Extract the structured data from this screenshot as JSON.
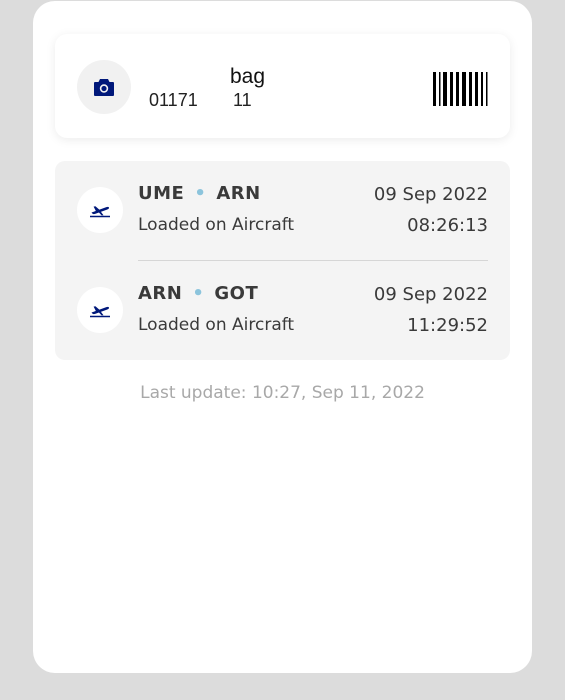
{
  "bag": {
    "title": "bag",
    "number_prefix": "01171",
    "number_suffix": "11",
    "camera_icon": "camera-icon",
    "barcode_icon": "barcode-icon"
  },
  "segments": [
    {
      "origin": "UME",
      "separator": "•",
      "destination": "ARN",
      "status": "Loaded on Aircraft",
      "date": "09 Sep 2022",
      "time": "08:26:13",
      "icon": "airplane-departure-icon"
    },
    {
      "origin": "ARN",
      "separator": "•",
      "destination": "GOT",
      "status": "Loaded on Aircraft",
      "date": "09 Sep 2022",
      "time": "11:29:52",
      "icon": "airplane-departure-icon"
    }
  ],
  "footer": {
    "last_update": "Last update: 10:27, Sep 11, 2022"
  },
  "colors": {
    "brand_blue": "#00187a",
    "dot_accent": "#8cc4dc",
    "text_dark": "#3a3a3a",
    "text_muted": "#a8a8a8"
  }
}
